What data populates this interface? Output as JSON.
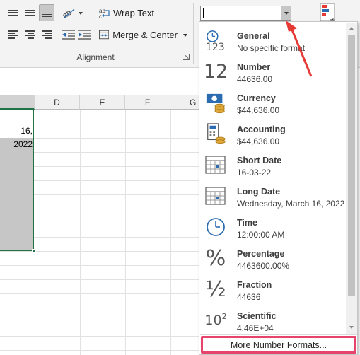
{
  "ribbon": {
    "wrap_text_label": "Wrap Text",
    "merge_center_label": "Merge & Center",
    "alignment_group_label": "Alignment",
    "number_format_value": ""
  },
  "grid": {
    "columns": [
      "D",
      "E",
      "F",
      "G"
    ],
    "active_cell_text": "16, 2022"
  },
  "number_formats": [
    {
      "name": "General",
      "sample": "No specific format",
      "icon": "general-icon"
    },
    {
      "name": "Number",
      "sample": "44636.00",
      "icon": "number-icon"
    },
    {
      "name": "Currency",
      "sample": "$44,636.00",
      "icon": "currency-icon"
    },
    {
      "name": "Accounting",
      "sample": " $44,636.00",
      "icon": "accounting-icon"
    },
    {
      "name": "Short Date",
      "sample": "16-03-22",
      "icon": "short-date-icon"
    },
    {
      "name": "Long Date",
      "sample": "Wednesday, March 16, 2022",
      "icon": "long-date-icon"
    },
    {
      "name": "Time",
      "sample": "12:00:00 AM",
      "icon": "time-icon"
    },
    {
      "name": "Percentage",
      "sample": "4463600.00%",
      "icon": "percentage-icon"
    },
    {
      "name": "Fraction",
      "sample": "44636",
      "icon": "fraction-icon"
    },
    {
      "name": "Scientific",
      "sample": "4.46E+04",
      "icon": "scientific-icon"
    }
  ],
  "more_formats": {
    "first": "M",
    "rest": "ore Number Formats..."
  },
  "icon_glyphs": {
    "general": "123",
    "number": "12",
    "percentage": "%",
    "fraction": "½",
    "scientific_base": "10",
    "scientific_exp": "2"
  },
  "colors": {
    "accent_green": "#217346",
    "highlight_pink": "#e8436b",
    "arrow_red": "#e53935"
  }
}
